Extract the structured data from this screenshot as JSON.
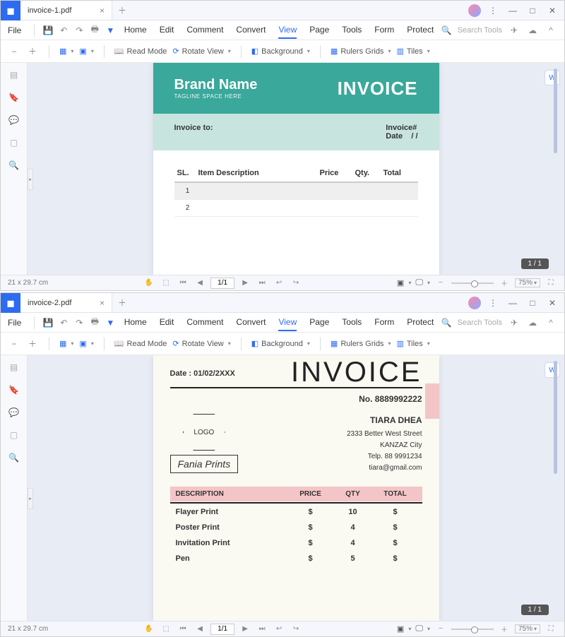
{
  "win1": {
    "tab_title": "invoice-1.pdf",
    "file_label": "File",
    "menu": {
      "home": "Home",
      "edit": "Edit",
      "comment": "Comment",
      "convert": "Convert",
      "view": "View",
      "page": "Page",
      "tools": "Tools",
      "form": "Form",
      "protect": "Protect"
    },
    "search_placeholder": "Search Tools",
    "toolbar": {
      "read_mode": "Read Mode",
      "rotate_view": "Rotate View",
      "background": "Background",
      "rulers_grids": "Rulers  Grids",
      "tiles": "Tiles"
    },
    "status": {
      "dims": "21 x 29.7 cm",
      "page": "1/1",
      "zoom": "75%",
      "badge": "1 / 1"
    }
  },
  "doc1": {
    "brand_name": "Brand Name",
    "brand_tag": "TAGLINE SPACE HERE",
    "invoice_title": "INVOICE",
    "invoice_to": "Invoice to:",
    "invoice_no": "Invoice#",
    "date": "Date",
    "date_sep": "/      /",
    "cols": {
      "sl": "SL.",
      "desc": "Item Description",
      "price": "Price",
      "qty": "Qty.",
      "total": "Total"
    },
    "rows": [
      "1",
      "2"
    ]
  },
  "win2": {
    "tab_title": "invoice-2.pdf",
    "file_label": "File",
    "menu": {
      "home": "Home",
      "edit": "Edit",
      "comment": "Comment",
      "convert": "Convert",
      "view": "View",
      "page": "Page",
      "tools": "Tools",
      "form": "Form",
      "protect": "Protect"
    },
    "search_placeholder": "Search Tools",
    "toolbar": {
      "read_mode": "Read Mode",
      "rotate_view": "Rotate View",
      "background": "Background",
      "rulers_grids": "Rulers  Grids",
      "tiles": "Tiles"
    },
    "status": {
      "dims": "21 x 29.7 cm",
      "page": "1/1",
      "zoom": "75%",
      "badge": "1 / 1"
    }
  },
  "doc2": {
    "date": "Date : 01/02/2XXX",
    "title": "INVOICE",
    "number": "No. 8889992222",
    "logo": "LOGO",
    "company": "Fania Prints",
    "customer": {
      "name": "TIARA DHEA",
      "street": "2333 Better West Street",
      "city": "KANZAZ City",
      "phone": "Telp. 88 9991234",
      "email": "tiara@gmail.com"
    },
    "cols": {
      "desc": "DESCRIPTION",
      "price": "PRICE",
      "qty": "QTY",
      "total": "TOTAL"
    },
    "rows": [
      {
        "d": "Flayer Print",
        "p": "$",
        "q": "10",
        "t": "$"
      },
      {
        "d": "Poster Print",
        "p": "$",
        "q": "4",
        "t": "$"
      },
      {
        "d": "Invitation Print",
        "p": "$",
        "q": "4",
        "t": "$"
      },
      {
        "d": "Pen",
        "p": "$",
        "q": "5",
        "t": "$"
      }
    ]
  }
}
